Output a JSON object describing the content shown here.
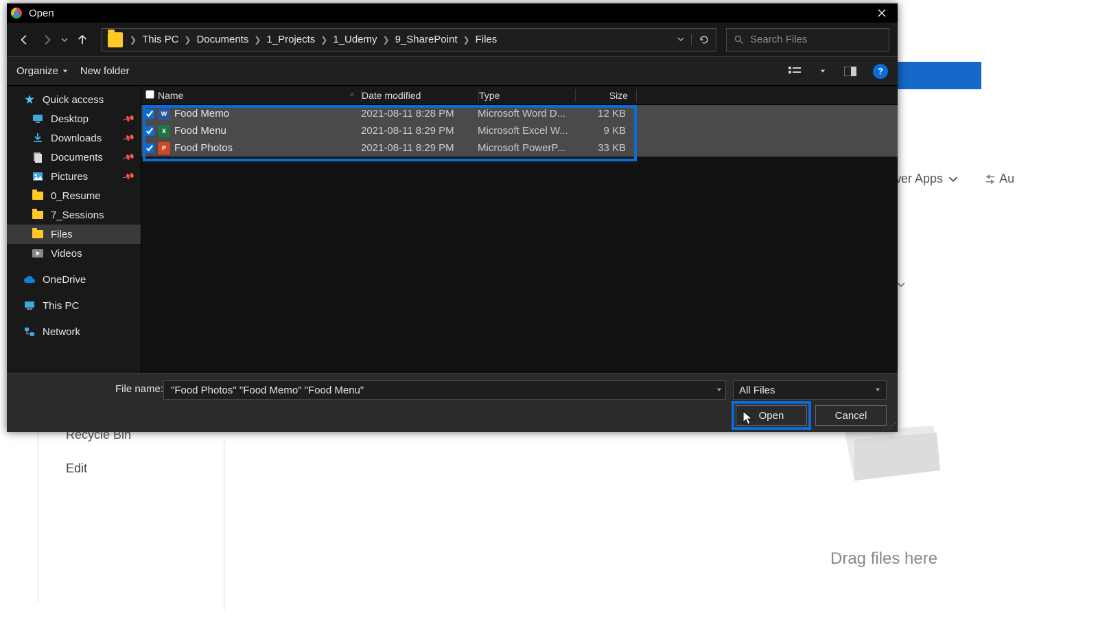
{
  "window": {
    "title": "Open"
  },
  "breadcrumb": [
    "This PC",
    "Documents",
    "1_Projects",
    "1_Udemy",
    "9_SharePoint",
    "Files"
  ],
  "search": {
    "placeholder": "Search Files"
  },
  "toolbar": {
    "organize": "Organize",
    "newfolder": "New folder"
  },
  "sidebar": {
    "quick": "Quick access",
    "desktop": "Desktop",
    "downloads": "Downloads",
    "documents": "Documents",
    "pictures": "Pictures",
    "resume": "0_Resume",
    "sessions": "7_Sessions",
    "files": "Files",
    "videos": "Videos",
    "onedrive": "OneDrive",
    "thispc": "This PC",
    "network": "Network"
  },
  "columns": {
    "name": "Name",
    "date": "Date modified",
    "type": "Type",
    "size": "Size"
  },
  "files": {
    "row0": {
      "name": "Food Memo",
      "date": "2021-08-11 8:28 PM",
      "type": "Microsoft Word D...",
      "size": "12 KB"
    },
    "row1": {
      "name": "Food Menu",
      "date": "2021-08-11 8:29 PM",
      "type": "Microsoft Excel W...",
      "size": "9 KB"
    },
    "row2": {
      "name": "Food Photos",
      "date": "2021-08-11 8:29 PM",
      "type": "Microsoft PowerP...",
      "size": "33 KB"
    }
  },
  "footer": {
    "filename_label": "File name:",
    "filename_value": "\"Food Photos\" \"Food Memo\" \"Food Menu\"",
    "filter": "All Files",
    "open": "Open",
    "cancel": "Cancel"
  },
  "backdrop": {
    "apps": "wer Apps",
    "au": "Au",
    "recycle": "Recycle Bin",
    "edit": "Edit",
    "drag": "Drag files here"
  }
}
